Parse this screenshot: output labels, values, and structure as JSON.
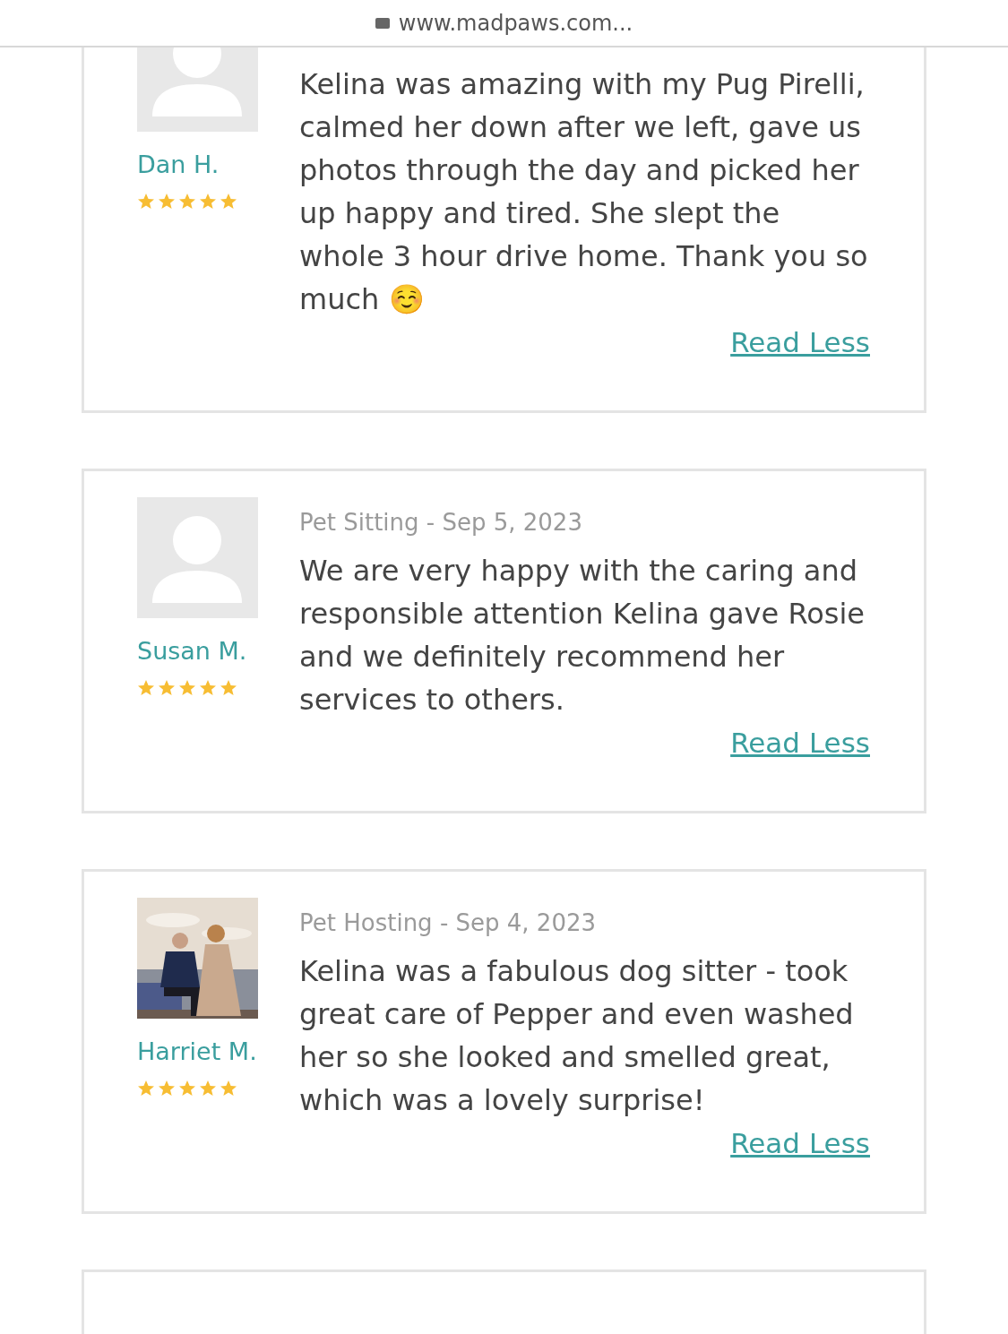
{
  "address_bar": {
    "url": "www.madpaws.com..."
  },
  "reviews": [
    {
      "name": "Dan H.",
      "avatar": {
        "kind": "placeholder"
      },
      "stars": 5,
      "text": "Kelina was amazing with my Pug Pirelli, calmed her down after we left, gave us photos through the day and picked her up happy and tired. She slept the whole 3 hour drive home. Thank you so much ☺️",
      "link": "Read Less"
    },
    {
      "name": "Susan M.",
      "avatar": {
        "kind": "placeholder"
      },
      "stars": 5,
      "date": "Pet Sitting - Sep 5, 2023",
      "text": "We are very happy with the caring and responsible attention Kelina gave Rosie and we definitely recommend her services to others.",
      "link": "Read Less"
    },
    {
      "name": "Harriet M.",
      "stars": 5,
      "date": "Pet Hosting - Sep 4, 2023",
      "text": "Kelina was a fabulous dog sitter - took great care of Pepper and even washed her so she looked and smelled great, which was a lovely surprise!",
      "link": "Read Less"
    }
  ]
}
